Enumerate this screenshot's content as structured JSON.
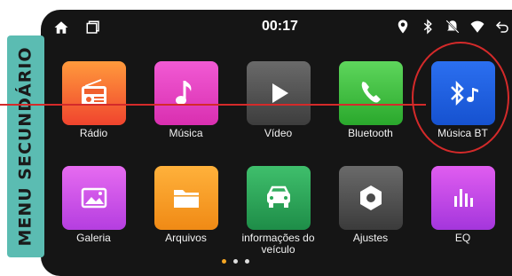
{
  "status": {
    "time": "00:17"
  },
  "side_tab": {
    "label": "MENU SECUNDÁRIO"
  },
  "apps": [
    {
      "label": "Rádio",
      "icon": "radio-icon"
    },
    {
      "label": "Música",
      "icon": "music-note-icon"
    },
    {
      "label": "Vídeo",
      "icon": "play-icon"
    },
    {
      "label": "Bluetooth",
      "icon": "phone-icon"
    },
    {
      "label": "Música BT",
      "icon": "bluetooth-music-icon"
    },
    {
      "label": "Galeria",
      "icon": "gallery-icon"
    },
    {
      "label": "Arquivos",
      "icon": "folder-icon"
    },
    {
      "label": "informações do veículo",
      "icon": "car-icon"
    },
    {
      "label": "Ajustes",
      "icon": "settings-icon"
    },
    {
      "label": "EQ",
      "icon": "equalizer-icon"
    }
  ],
  "pager": {
    "pages": 3,
    "current": 1
  },
  "colors": {
    "side_tab": "#5bbcb2",
    "highlight": "#d42a2a",
    "screen_bg": "#151515"
  }
}
